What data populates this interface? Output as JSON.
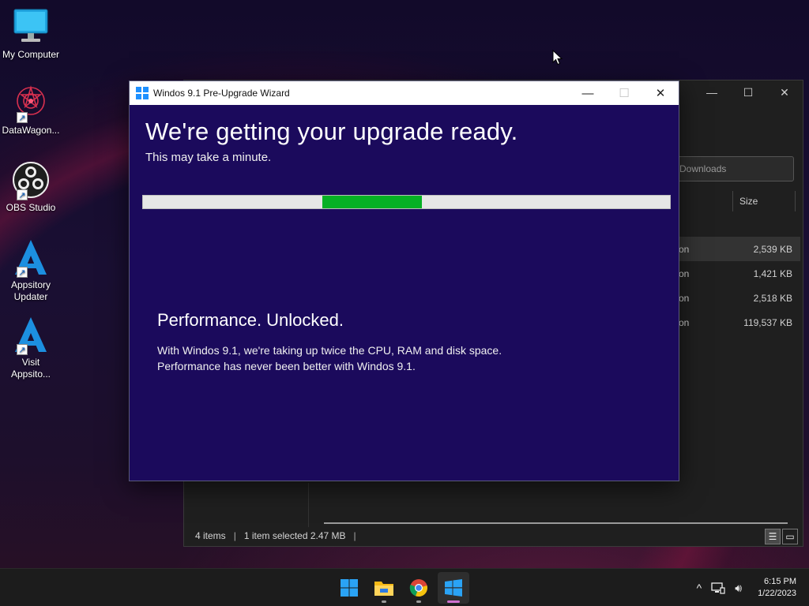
{
  "desktop": {
    "icons": [
      {
        "label": "My Computer",
        "icon": "monitor-icon"
      },
      {
        "label": "DataWagon...",
        "icon": "datawagon-icon"
      },
      {
        "label": "OBS Studio",
        "icon": "obs-icon"
      },
      {
        "label": "Appsitory\nUpdater",
        "icon": "appsitory-icon"
      },
      {
        "label": "Visit\nAppsito...",
        "icon": "appsitory-icon"
      }
    ]
  },
  "explorer": {
    "search_placeholder": "rch Downloads",
    "column_size": "Size",
    "rows": [
      {
        "type": "on",
        "size": "2,539 KB",
        "selected": true
      },
      {
        "type": "on",
        "size": "1,421 KB",
        "selected": false
      },
      {
        "type": "on",
        "size": "2,518 KB",
        "selected": false
      },
      {
        "type": "on",
        "size": "119,537 KB",
        "selected": false
      }
    ],
    "status": {
      "items": "4 items",
      "selection": "1 item selected  2.47 MB"
    }
  },
  "wizard": {
    "title": "Windos 9.1 Pre-Upgrade Wizard",
    "heading": "We're getting your upgrade ready.",
    "subheading": "This may take a minute.",
    "progress": {
      "start": 0.34,
      "end": 0.53,
      "color": "#06b025"
    },
    "promo_title": "Performance. Unlocked.",
    "promo_line1": "With Windos 9.1, we're taking up twice the CPU, RAM and disk space.",
    "promo_line2": "Performance has never been better with Windos 9.1."
  },
  "taskbar": {
    "apps": [
      "start-icon",
      "file-explorer-icon",
      "chrome-icon",
      "windos-wizard-icon"
    ],
    "time": "6:15 PM",
    "date": "1/22/2023"
  },
  "colors": {
    "wizard_bg": "#1b0a5c",
    "progress_fill": "#06b025",
    "accent_blue": "#1e90ff"
  }
}
